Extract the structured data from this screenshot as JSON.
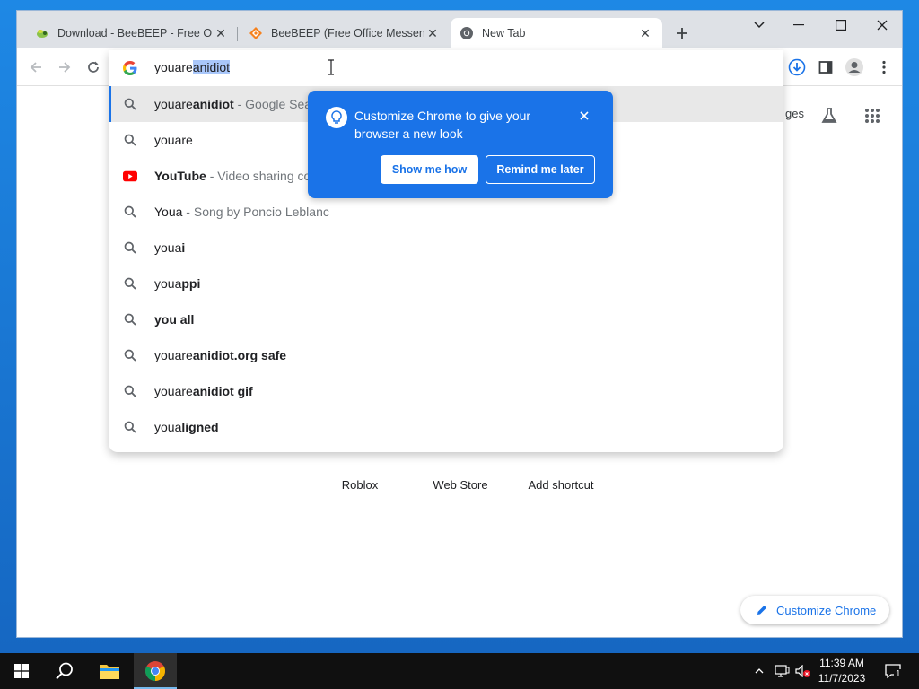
{
  "browser": {
    "tabs": [
      {
        "title": "Download - BeeBEEP - Free Offic",
        "favicon": "beebeep-icon"
      },
      {
        "title": "BeeBEEP (Free Office Messenger",
        "favicon": "sourceforge-icon"
      },
      {
        "title": "New Tab",
        "favicon": "chrome-icon",
        "active": true
      }
    ],
    "window_controls": [
      "chevron-down-icon",
      "minimize-icon",
      "maximize-icon",
      "close-icon"
    ]
  },
  "omnibox": {
    "typed": "youare",
    "autocomplete": "anidiot",
    "suggestions": [
      {
        "icon": "search-icon",
        "plain": "youare",
        "bold": "anidiot",
        "desc": " - Google Sea",
        "highlight": true
      },
      {
        "icon": "search-icon",
        "plain": "youare",
        "bold": "",
        "desc": ""
      },
      {
        "icon": "youtube-icon",
        "plain": "",
        "bold": "YouTube",
        "desc": " - Video sharing co"
      },
      {
        "icon": "search-icon",
        "plain": "Youa",
        "bold": "",
        "desc": " - Song by Poncio Leblanc"
      },
      {
        "icon": "search-icon",
        "plain": "youa",
        "bold": "i",
        "desc": ""
      },
      {
        "icon": "search-icon",
        "plain": "youa",
        "bold": "ppi",
        "desc": ""
      },
      {
        "icon": "search-icon",
        "plain": "",
        "bold": "you all",
        "desc": ""
      },
      {
        "icon": "search-icon",
        "plain": "youare",
        "bold": "anidiot.org safe",
        "desc": ""
      },
      {
        "icon": "search-icon",
        "plain": "youare",
        "bold": "anidiot gif",
        "desc": ""
      },
      {
        "icon": "search-icon",
        "plain": "youa",
        "bold": "ligned",
        "desc": ""
      }
    ]
  },
  "promo": {
    "text": "Customize Chrome to give your browser a new look",
    "primary": "Show me how",
    "secondary": "Remind me later"
  },
  "ntp": {
    "images_partial": "ges",
    "shortcuts": [
      "Roblox",
      "Web Store",
      "Add shortcut"
    ],
    "customize": "Customize Chrome"
  },
  "taskbar": {
    "time": "11:39 AM",
    "date": "11/7/2023",
    "notifications": "1"
  }
}
